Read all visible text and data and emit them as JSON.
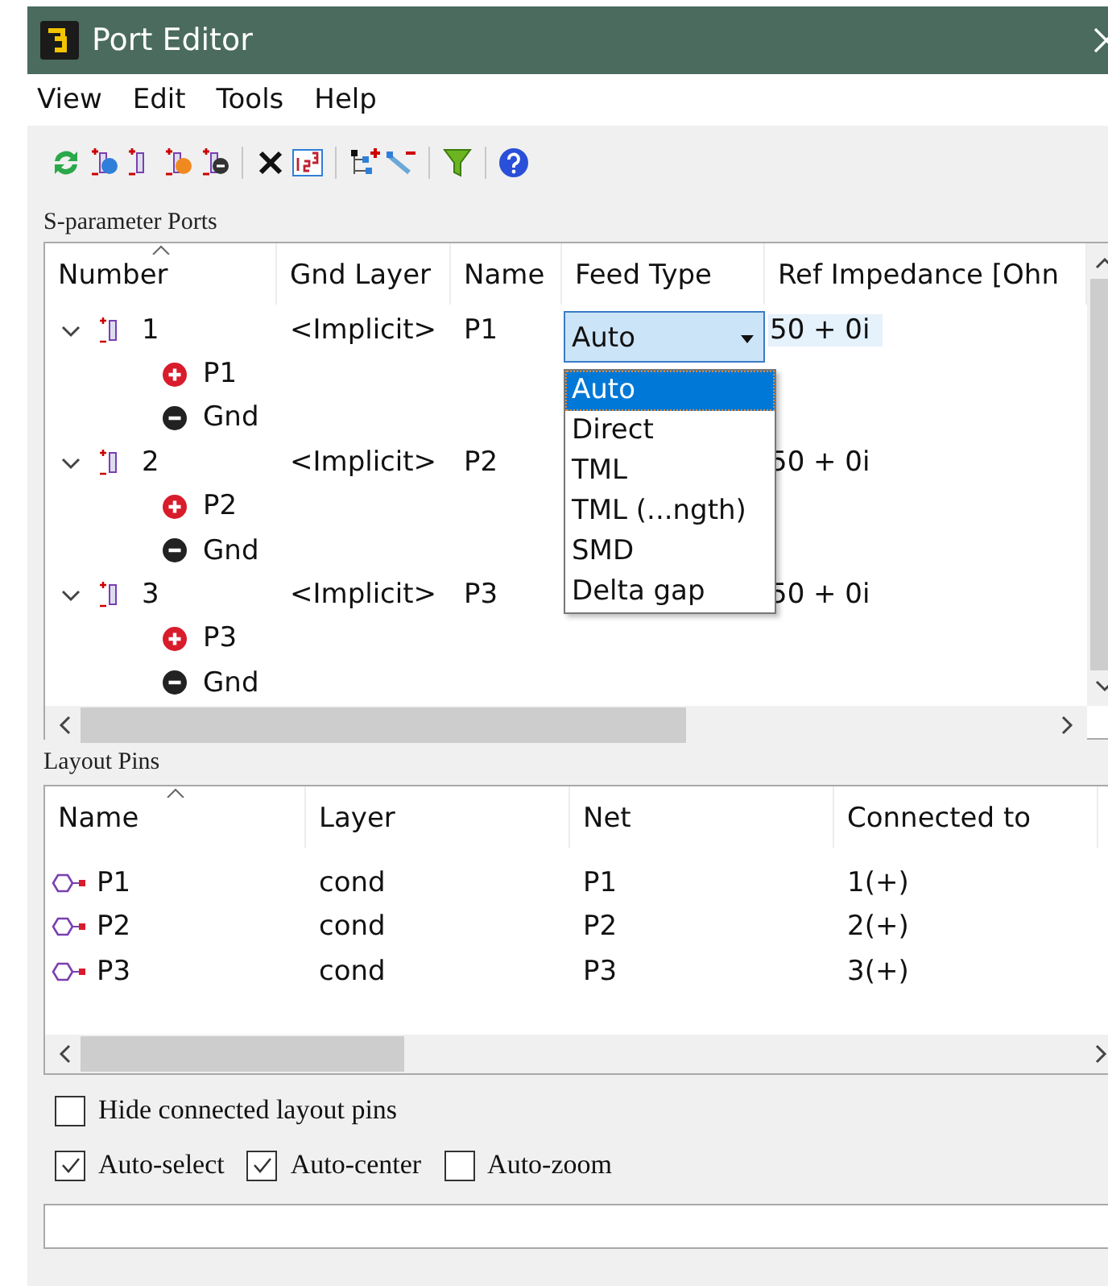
{
  "window": {
    "title": "Port Editor"
  },
  "menu": [
    "View",
    "Edit",
    "Tools",
    "Help"
  ],
  "sparameter_ports": {
    "label": "S-parameter Ports",
    "columns": [
      {
        "label": "Number",
        "sorted": true
      },
      {
        "label": "Gnd Layer",
        "sorted": false
      },
      {
        "label": "Name",
        "sorted": false
      },
      {
        "label": "Feed Type",
        "sorted": false
      },
      {
        "label": "Ref Impedance [Ohn",
        "sorted": false
      }
    ],
    "rows": [
      {
        "number": "1",
        "gnd_layer": "<Implicit>",
        "name": "P1",
        "feed_type": "Auto",
        "ref_impedance": "50 + 0i",
        "expanded": true,
        "selected": true,
        "feed_type_options": [
          {
            "label": "Auto",
            "selected": true
          },
          {
            "label": "Direct",
            "selected": false
          },
          {
            "label": "TML",
            "selected": false
          },
          {
            "label": "TML (...ngth)",
            "selected": false
          },
          {
            "label": "SMD",
            "selected": false
          },
          {
            "label": "Delta gap",
            "selected": false
          }
        ],
        "children": [
          {
            "kind": "plus",
            "label": "P1"
          },
          {
            "kind": "minus",
            "label": "Gnd"
          }
        ]
      },
      {
        "number": "2",
        "gnd_layer": "<Implicit>",
        "name": "P2",
        "ref_impedance": "50 + 0i",
        "expanded": true,
        "selected": false,
        "children": [
          {
            "kind": "plus",
            "label": "P2"
          },
          {
            "kind": "minus",
            "label": "Gnd"
          }
        ]
      },
      {
        "number": "3",
        "gnd_layer": "<Implicit>",
        "name": "P3",
        "ref_impedance": "50 + 0i",
        "expanded": true,
        "selected": false,
        "children": [
          {
            "kind": "plus",
            "label": "P3"
          },
          {
            "kind": "minus",
            "label": "Gnd"
          }
        ]
      }
    ]
  },
  "layout_pins": {
    "label": "Layout Pins",
    "columns": [
      {
        "label": "Name",
        "sorted": true
      },
      {
        "label": "Layer",
        "sorted": false
      },
      {
        "label": "Net",
        "sorted": false
      },
      {
        "label": "Connected to",
        "sorted": false
      }
    ],
    "rows": [
      {
        "name": "P1",
        "layer": "cond",
        "net": "P1",
        "connected_to": "1(+)"
      },
      {
        "name": "P2",
        "layer": "cond",
        "net": "P2",
        "connected_to": "2(+)"
      },
      {
        "name": "P3",
        "layer": "cond",
        "net": "P3",
        "connected_to": "3(+)"
      }
    ]
  },
  "options": [
    [
      {
        "label": "Hide connected layout pins",
        "checked": false
      }
    ],
    [
      {
        "label": "Auto-select",
        "checked": true
      },
      {
        "label": "Auto-center",
        "checked": true
      },
      {
        "label": "Auto-zoom",
        "checked": false
      }
    ]
  ]
}
